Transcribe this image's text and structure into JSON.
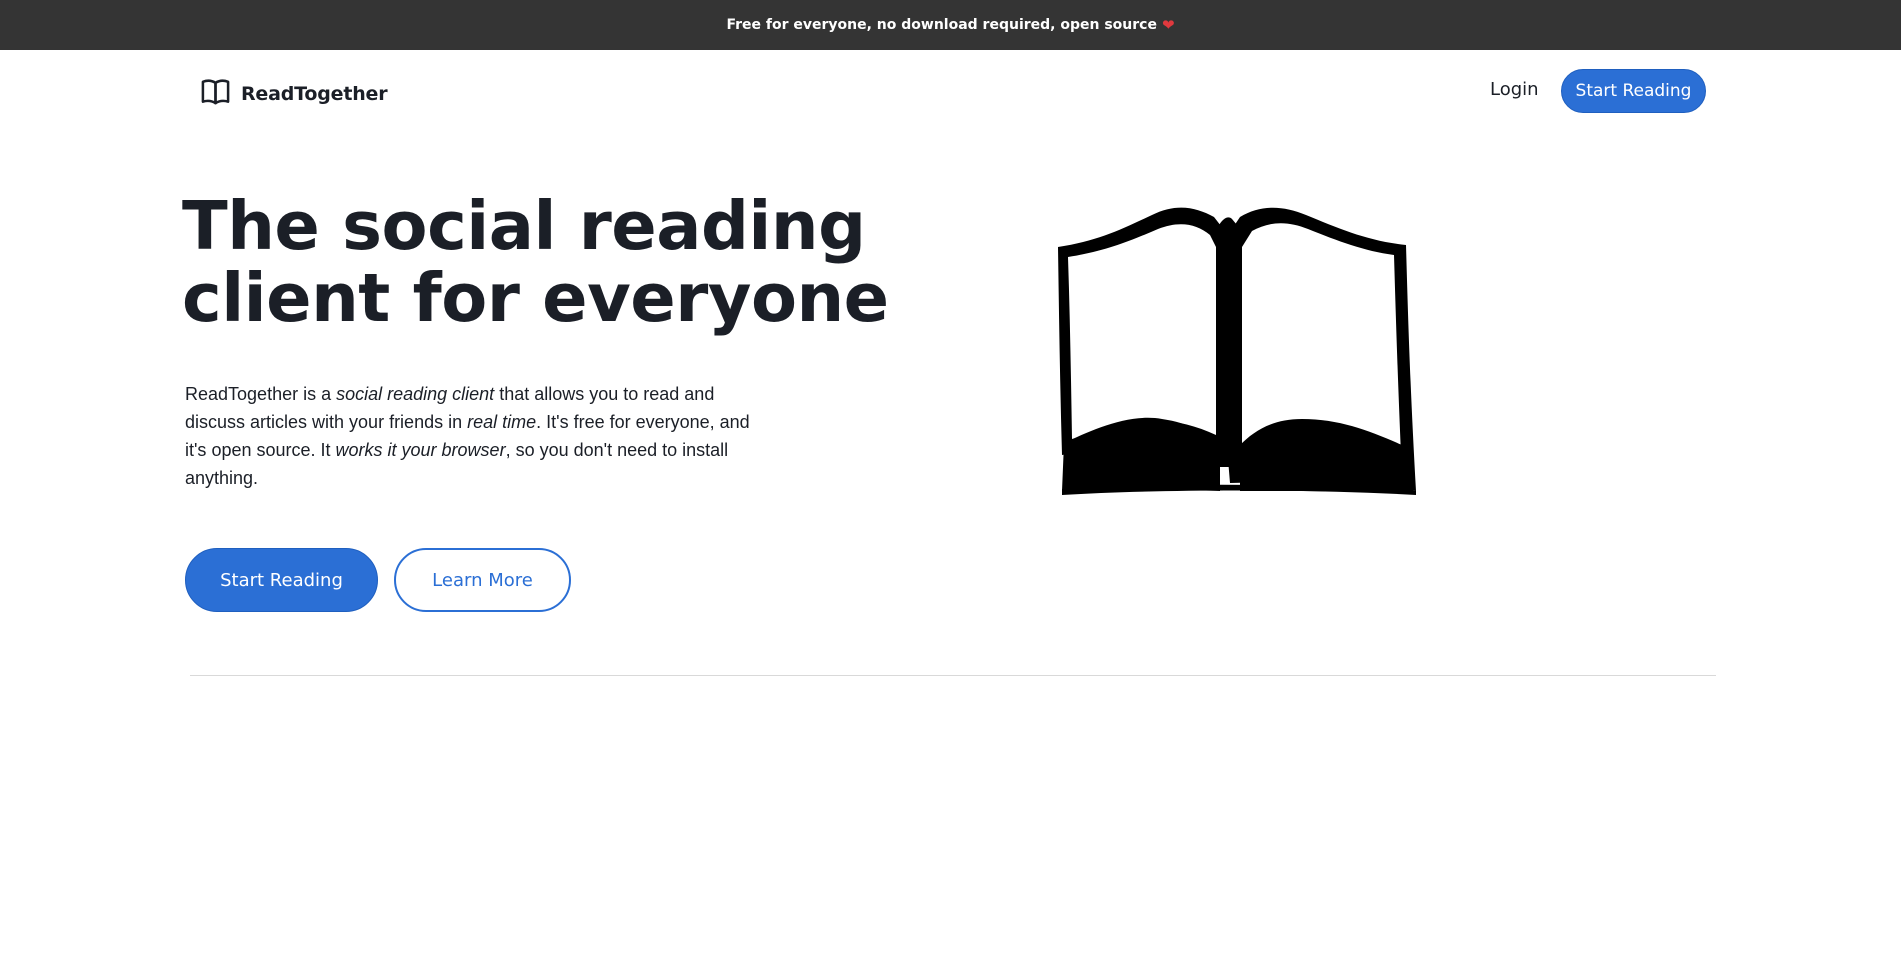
{
  "announcement": {
    "text": "Free for everyone, no download required, open source",
    "icon": "heart-icon",
    "heart": "❤"
  },
  "navbar": {
    "brand_name": "ReadTogether",
    "brand_icon": "open-book-icon",
    "login_label": "Login",
    "cta_label": "Start Reading"
  },
  "hero": {
    "title": "The social reading client for everyone",
    "description": {
      "p1": "ReadTogether is a ",
      "em1": "social reading client",
      "p2": " that allows you to read and discuss articles with your friends in ",
      "em2": "real time",
      "p3": ". It's free for everyone, and it's open source. It ",
      "em3": "works it your browser",
      "p4": ", so you don't need to install anything."
    },
    "primary_button": "Start Reading",
    "secondary_button": "Learn More",
    "illustration": "open-book-illustration"
  },
  "colors": {
    "accent": "#2b6fd5",
    "announcement_bg": "#343434",
    "text": "#1b1f27",
    "heart": "#e0393e"
  }
}
